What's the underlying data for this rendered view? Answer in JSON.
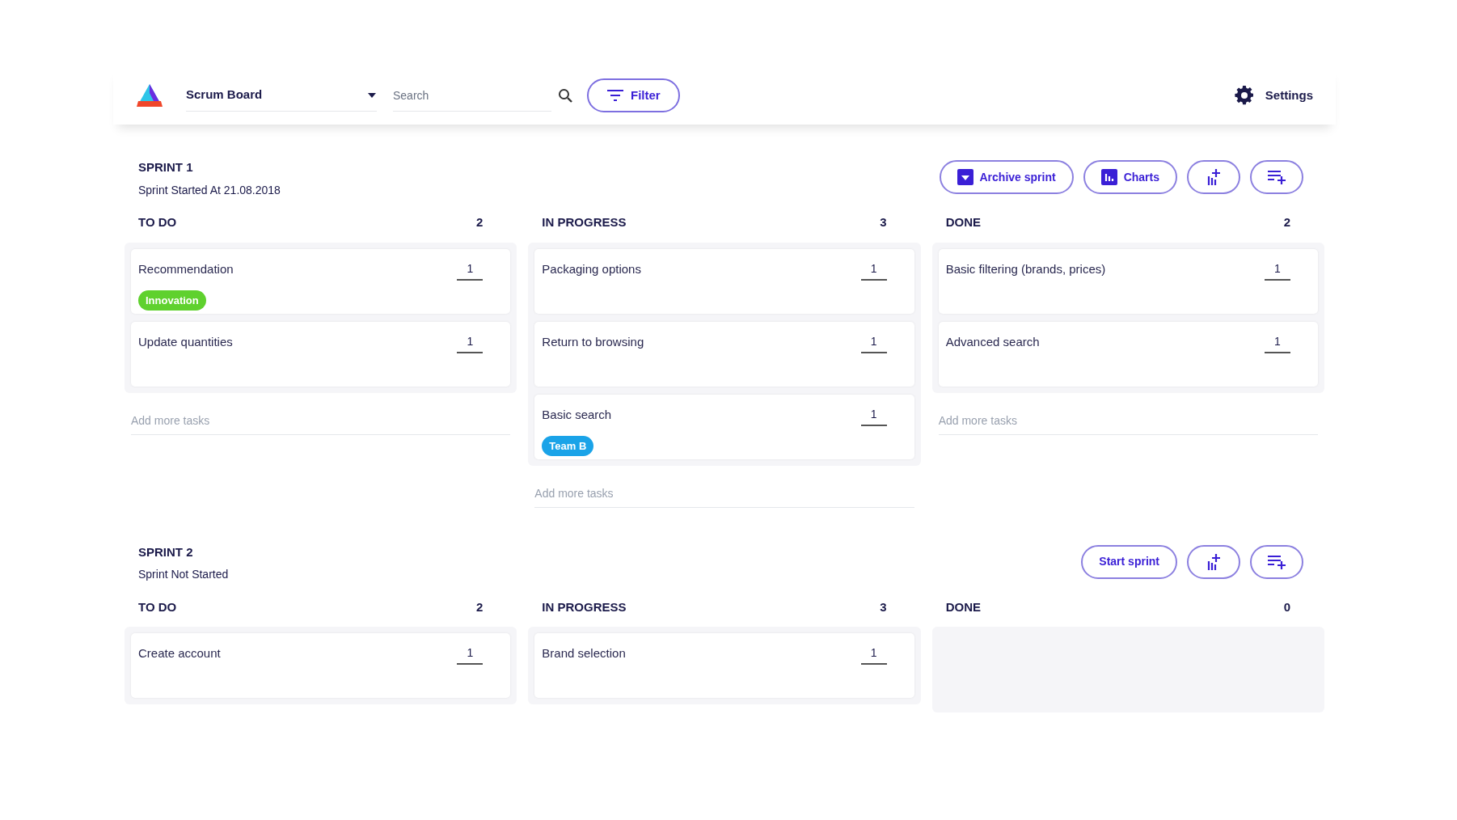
{
  "header": {
    "board": "Scrum Board",
    "search": {
      "placeholder": "Search"
    },
    "filter": "Filter",
    "settings": "Settings"
  },
  "sprints": [
    {
      "title": "SPRINT 1",
      "subtitle": "Sprint Started At 21.08.2018",
      "actions": [
        {
          "kind": "archive",
          "label": "Archive sprint"
        },
        {
          "kind": "charts",
          "label": "Charts"
        },
        {
          "kind": "add-column"
        },
        {
          "kind": "add-task"
        }
      ],
      "columns": [
        {
          "name": "TO DO",
          "count": "2",
          "add": "Add more tasks",
          "cards": [
            {
              "title": "Recommendation",
              "points": "1",
              "tag": {
                "label": "Innovation",
                "color": "#5fd12e"
              }
            },
            {
              "title": "Update quantities",
              "points": "1"
            }
          ]
        },
        {
          "name": "IN PROGRESS",
          "count": "3",
          "add": "Add more tasks",
          "cards": [
            {
              "title": "Packaging options",
              "points": "1"
            },
            {
              "title": "Return to browsing",
              "points": "1"
            },
            {
              "title": "Basic search",
              "points": "1",
              "tag": {
                "label": "Team B",
                "color": "#1aa3e8"
              }
            }
          ]
        },
        {
          "name": "DONE",
          "count": "2",
          "add": "Add more tasks",
          "cards": [
            {
              "title": "Basic filtering (brands, prices)",
              "points": "1"
            },
            {
              "title": "Advanced search",
              "points": "1"
            }
          ]
        }
      ]
    },
    {
      "title": "SPRINT 2",
      "subtitle": "Sprint Not Started",
      "actions": [
        {
          "kind": "start",
          "label": "Start sprint"
        },
        {
          "kind": "add-column"
        },
        {
          "kind": "add-task"
        }
      ],
      "columns": [
        {
          "name": "TO DO",
          "count": "2",
          "cards": [
            {
              "title": "Create account",
              "points": "1"
            }
          ]
        },
        {
          "name": "IN PROGRESS",
          "count": "3",
          "cards": [
            {
              "title": "Brand selection",
              "points": "1"
            }
          ]
        },
        {
          "name": "DONE",
          "count": "0"
        }
      ]
    }
  ]
}
